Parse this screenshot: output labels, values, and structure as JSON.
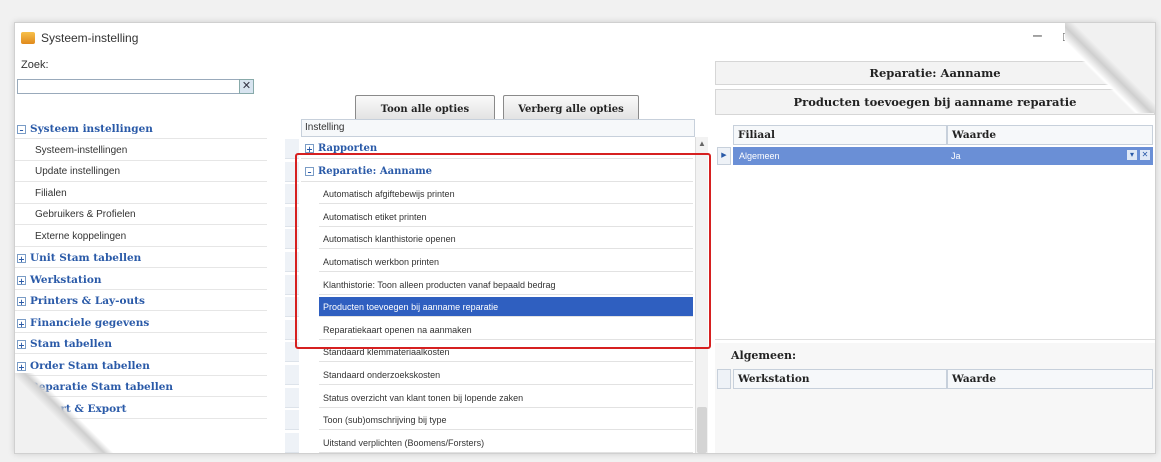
{
  "window": {
    "title": "Systeem-instelling",
    "min_symbol": "–",
    "max_symbol": "□"
  },
  "left": {
    "search_label": "Zoek:",
    "search_value": "",
    "clear_symbol": "✕",
    "tree": [
      {
        "label": "Systeem instellingen",
        "kind": "cat",
        "exp": "–"
      },
      {
        "label": "Systeem-instellingen",
        "kind": "sub"
      },
      {
        "label": "Update instellingen",
        "kind": "sub"
      },
      {
        "label": "Filialen",
        "kind": "sub"
      },
      {
        "label": "Gebruikers & Profielen",
        "kind": "sub"
      },
      {
        "label": "Externe koppelingen",
        "kind": "sub"
      },
      {
        "label": "Unit Stam tabellen",
        "kind": "cat",
        "exp": "+"
      },
      {
        "label": "Werkstation",
        "kind": "cat",
        "exp": "+"
      },
      {
        "label": "Printers & Lay-outs",
        "kind": "cat",
        "exp": "+"
      },
      {
        "label": "Financiele gegevens",
        "kind": "cat",
        "exp": "+"
      },
      {
        "label": "Stam tabellen",
        "kind": "cat",
        "exp": "+"
      },
      {
        "label": "Order Stam tabellen",
        "kind": "cat",
        "exp": "+"
      },
      {
        "label": "Reparatie Stam tabellen",
        "kind": "cat",
        "exp": "+"
      },
      {
        "label": "Import & Export",
        "kind": "cat",
        "exp": "+"
      }
    ]
  },
  "middle": {
    "show_all_label": "Toon alle opties",
    "hide_all_label": "Verberg alle opties",
    "column_header": "Instelling",
    "rows": [
      {
        "label": "Rapporten",
        "kind": "cat",
        "exp": "+"
      },
      {
        "label": "Reparatie: Aanname",
        "kind": "cat",
        "exp": "–"
      },
      {
        "label": "Automatisch afgiftebewijs printen",
        "kind": "item"
      },
      {
        "label": "Automatisch etiket printen",
        "kind": "item"
      },
      {
        "label": "Automatisch klanthistorie openen",
        "kind": "item"
      },
      {
        "label": "Automatisch werkbon printen",
        "kind": "item"
      },
      {
        "label": "Klanthistorie: Toon alleen producten vanaf bepaald bedrag",
        "kind": "item"
      },
      {
        "label": "Producten toevoegen bij aanname reparatie",
        "kind": "item",
        "selected": true
      },
      {
        "label": "Reparatiekaart openen na aanmaken",
        "kind": "item"
      },
      {
        "label": "Standaard klemmateriaalkosten",
        "kind": "item"
      },
      {
        "label": "Standaard onderzoekskosten",
        "kind": "item"
      },
      {
        "label": "Status overzicht van klant tonen bij lopende zaken",
        "kind": "item"
      },
      {
        "label": "Toon (sub)omschrijving bij type",
        "kind": "item"
      },
      {
        "label": "Uitstand verplichten (Boomens/Forsters)",
        "kind": "item"
      }
    ]
  },
  "right": {
    "title": "Reparatie: Aanname",
    "subtitle": "Producten toevoegen bij aanname reparatie",
    "grid_headers": {
      "col1": "Filiaal",
      "col2": "Waarde"
    },
    "grid_row": {
      "filiaal": "Algemeen",
      "waarde": "Ja",
      "dropdown_symbol": "▾",
      "clear_symbol": "✕"
    },
    "lower_title": "Algemeen:",
    "lower_headers": {
      "col1": "Werkstation",
      "col2": "Waarde"
    }
  },
  "colors": {
    "accent": "#2a5aa8",
    "selection": "#2f5fc0",
    "highlight_box": "#d62020"
  }
}
